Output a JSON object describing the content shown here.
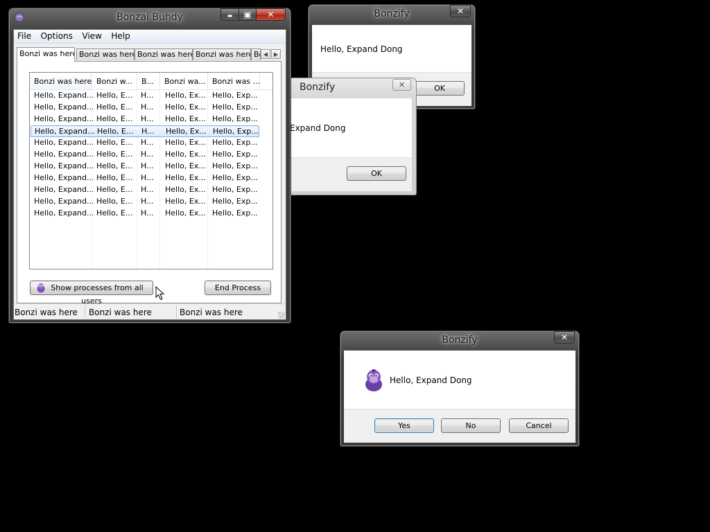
{
  "main_window": {
    "title": "Bonzai Buhdy",
    "minimize_glyph": "▬",
    "maximize_glyph": "▣",
    "close_glyph": "✕",
    "menu": [
      "File",
      "Options",
      "View",
      "Help"
    ],
    "tabs": [
      "Bonzi was here",
      "Bonzi was here",
      "Bonzi was here",
      "Bonzi was here",
      "Bo"
    ],
    "tab_scroll_left": "◀",
    "tab_scroll_right": "▶",
    "listview": {
      "columns": [
        "Bonzi was here",
        "Bonzi w...",
        "B...",
        "Bonzi wa...",
        "Bonzi was ..."
      ],
      "sorted_column": 0,
      "sort_glyph": "▲",
      "row_count": 11,
      "selected_row": 3,
      "row_cells": [
        "Hello, Expand...",
        "Hello, E...",
        "H...",
        "Hello, Ex...",
        "Hello, Exp..."
      ]
    },
    "show_processes_button": "Show processes from all users",
    "end_process_button": "End Process",
    "status": [
      "Bonzi was here",
      "Bonzi was here",
      "Bonzi was here"
    ]
  },
  "dialog_top": {
    "title": "Bonzify",
    "close_glyph": "✕",
    "message": "Hello, Expand Dong",
    "ok_button": "OK"
  },
  "dialog_middle": {
    "title": "Bonzify",
    "close_glyph": "✕",
    "message": "Expand Dong",
    "ok_button": "OK"
  },
  "dialog_bottom": {
    "title": "Bonzify",
    "close_glyph": "✕",
    "message": "Hello, Expand Dong",
    "yes_button": "Yes",
    "no_button": "No",
    "cancel_button": "Cancel"
  },
  "colors": {
    "desktop": "#000000",
    "close_button": "#c0473a",
    "selection": "#dbeafc",
    "bonzi_purple": "#7b4fb3"
  }
}
